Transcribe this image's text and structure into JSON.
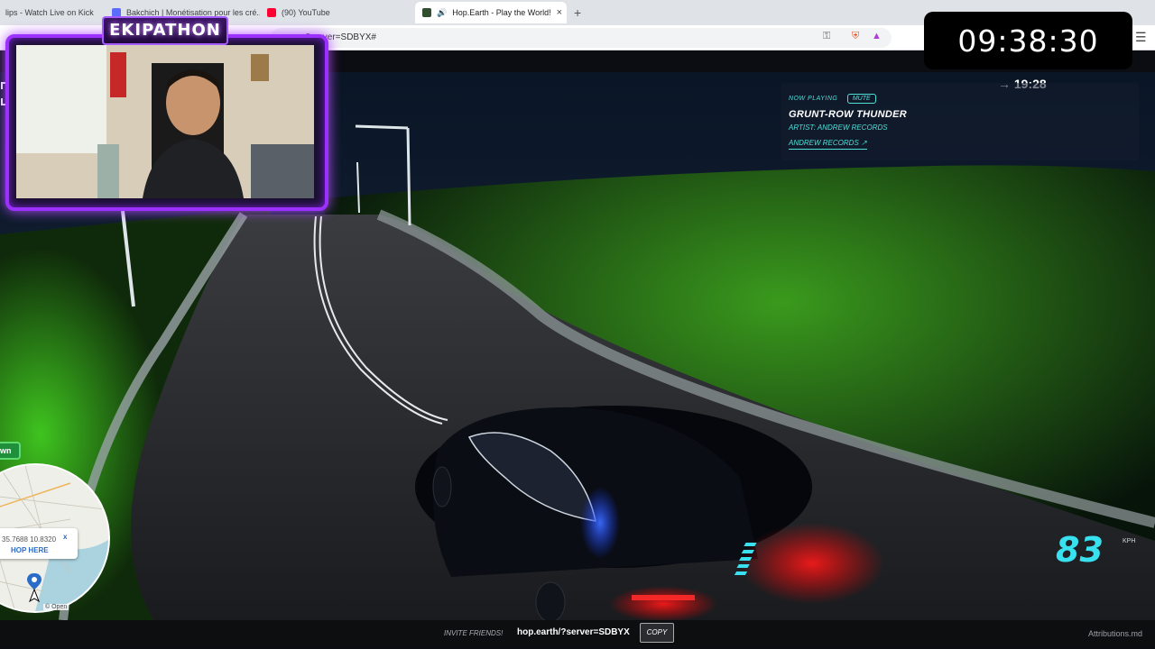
{
  "browser": {
    "tabs": [
      {
        "title": "lips - Watch Live on Kick",
        "favicon_color": "#53fc18"
      },
      {
        "title": "Bakchich | Monétisation pour les cré...",
        "favicon_color": "#5b6cff"
      },
      {
        "title": "(90) YouTube",
        "favicon_color": "#ff0033"
      },
      {
        "title": "Hop.Earth - Play the World!",
        "favicon_color": "#2f4f2f",
        "active": true
      }
    ],
    "close_glyph": "×",
    "new_tab_glyph": "+",
    "url": "...?server=SDBYX#"
  },
  "stream": {
    "timer": "09:38:30",
    "overlay_logo": "EKIPATHON"
  },
  "now_playing": {
    "label": "NOW PLAYING",
    "mute_label": "MUTE",
    "title": "GRUNT-ROW THUNDER",
    "artist": "ARTIST: ANDREW RECORDS",
    "link": "ANDREW RECORDS ↗"
  },
  "hud": {
    "race_time": "→ 19:28",
    "speed": "83",
    "speed_unit": "KPH",
    "green_tag": "wn"
  },
  "minimap": {
    "coords": "35.7688 10.8320",
    "hop_label": "HOP HERE",
    "close": "x",
    "attribution": "© Open"
  },
  "bottom_bar": {
    "invite_label": "INVITE FRIENDS!",
    "server_url": "hop.earth/?server=SDBYX",
    "copy_label": "COPY",
    "attributions": "Attributions.md"
  },
  "colors": {
    "accent_cyan": "#38e0f0",
    "overlay_purple": "#9b30ff",
    "grass_green": "#2f9a1a"
  }
}
